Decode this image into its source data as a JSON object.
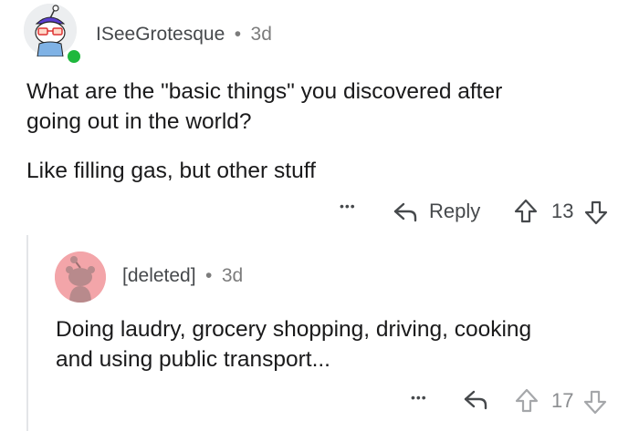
{
  "comment": {
    "username": "ISeeGrotesque",
    "separator": "•",
    "age": "3d",
    "body_line1": "What are the \"basic things\" you discovered after",
    "body_line2": "going out in the world?",
    "body_para2": "Like filling gas, but other stuff",
    "more_label": "•••",
    "reply_label": "Reply",
    "score": "13"
  },
  "reply": {
    "username": "[deleted]",
    "separator": "•",
    "age": "3d",
    "body_line1": "Doing laudry, grocery shopping, driving, cooking",
    "body_line2": "and using public transport...",
    "more_label": "•••",
    "score": "17"
  },
  "icons": [
    "avatar-icon",
    "online-status-icon",
    "reply-arrow-icon",
    "upvote-arrow-icon",
    "downvote-arrow-icon",
    "deleted-user-avatar-icon"
  ],
  "colors": {
    "online": "#1fb83d",
    "deleted_avatar_bg": "#f3a5a9",
    "text": "#1a1a1b",
    "meta": "#7c7c7c"
  }
}
